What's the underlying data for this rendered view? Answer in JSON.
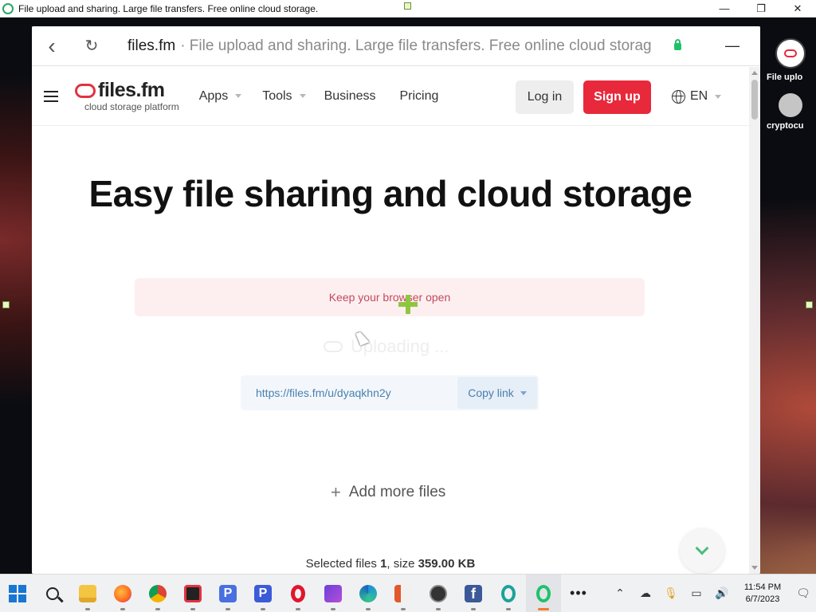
{
  "window": {
    "title": "File upload and sharing. Large file transfers. Free online cloud storage.",
    "controls": [
      "—",
      "❐",
      "✕"
    ]
  },
  "browser": {
    "domain": "files.fm",
    "title_rest": "· File upload and sharing. Large file transfers. Free online cloud storag",
    "back_icon": "‹",
    "reload_icon": "↻",
    "minimize_icon": "—"
  },
  "nav": {
    "logo_name": "files.fm",
    "logo_sub": "cloud storage platform",
    "items": [
      {
        "label": "Apps",
        "dropdown": true
      },
      {
        "label": "Tools",
        "dropdown": true
      },
      {
        "label": "Business",
        "dropdown": false
      },
      {
        "label": "Pricing",
        "dropdown": false
      }
    ],
    "login": "Log in",
    "signup": "Sign up",
    "language": "EN"
  },
  "main": {
    "headline": "Easy file sharing and cloud storage",
    "notice": "Keep your browser open",
    "uploading": "Uploading ...",
    "share_url": "https://files.fm/u/dyaqkhn2y",
    "copy_link": "Copy link",
    "add_more": "Add more files",
    "selected_prefix": "Selected files",
    "selected_count": "1",
    "size_label": ", size",
    "size_value": "359.00 KB"
  },
  "desktop_shortcuts": [
    {
      "label": "File uplo",
      "icon": "files-fm-icon"
    },
    {
      "label": "cryptocu",
      "icon": "crypto-icon"
    }
  ],
  "taskbar": {
    "time": "11:54 PM",
    "date": "6/7/2023",
    "apps": [
      "windows-start-icon",
      "search-icon",
      "file-explorer-icon",
      "firefox-icon",
      "chrome-icon",
      "screen-recorder-icon",
      "p-app-icon",
      "p-app-2-icon",
      "opera-icon",
      "video-editor-icon",
      "edge-icon",
      "office-icon",
      "media-player-icon",
      "facebook-icon",
      "opera-gx-icon",
      "opera-active-icon",
      "more-icon"
    ]
  },
  "colors": {
    "brand_red": "#e8293b",
    "notice_bg": "#fdeff0",
    "link_blue": "#4a7fb0",
    "accent_green": "#4bbd7d"
  }
}
